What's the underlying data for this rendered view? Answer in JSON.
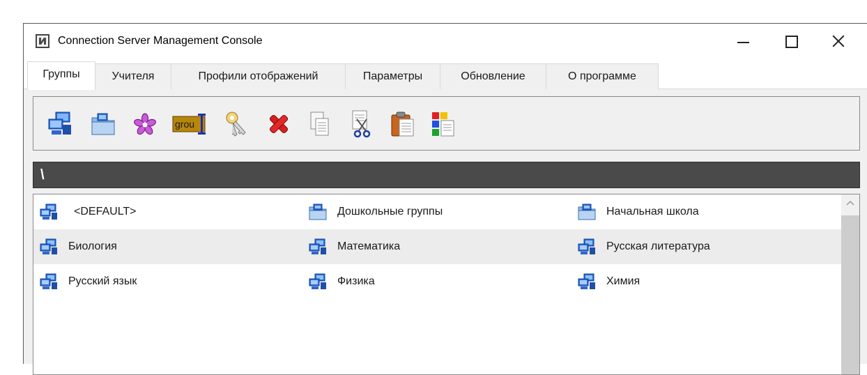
{
  "window": {
    "title": "Connection Server Management Console"
  },
  "tabs": [
    {
      "label": "Группы",
      "active": true
    },
    {
      "label": "Учителя"
    },
    {
      "label": "Профили отображений"
    },
    {
      "label": "Параметры"
    },
    {
      "label": "Обновление"
    },
    {
      "label": "О программе"
    }
  ],
  "toolbar": {
    "icons": [
      "new-group-icon",
      "new-folder-icon",
      "asterisk-icon",
      "rename-icon",
      "keys-icon",
      "delete-icon",
      "copy-icon",
      "cut-icon",
      "paste-icon",
      "color-schemes-icon"
    ],
    "rename_icon_text": "grou"
  },
  "path": {
    "current": "\\"
  },
  "groups": {
    "rows": [
      [
        {
          "label": "<DEFAULT>",
          "icon": "computers-icon"
        },
        {
          "label": "Дошкольные группы",
          "icon": "folder-icon"
        },
        {
          "label": "Начальная школа",
          "icon": "folder-icon"
        }
      ],
      [
        {
          "label": "Биология",
          "icon": "computers-icon"
        },
        {
          "label": "Математика",
          "icon": "computers-icon"
        },
        {
          "label": "Русская литература",
          "icon": "computers-icon"
        }
      ],
      [
        {
          "label": "Русский язык",
          "icon": "computers-icon"
        },
        {
          "label": "Физика",
          "icon": "computers-icon"
        },
        {
          "label": "Химия",
          "icon": "computers-icon"
        }
      ]
    ]
  },
  "colors": {
    "path_bar": "#4a4a4a",
    "selected_row": "#ececec",
    "accent_blue": "#1f5fbf"
  }
}
